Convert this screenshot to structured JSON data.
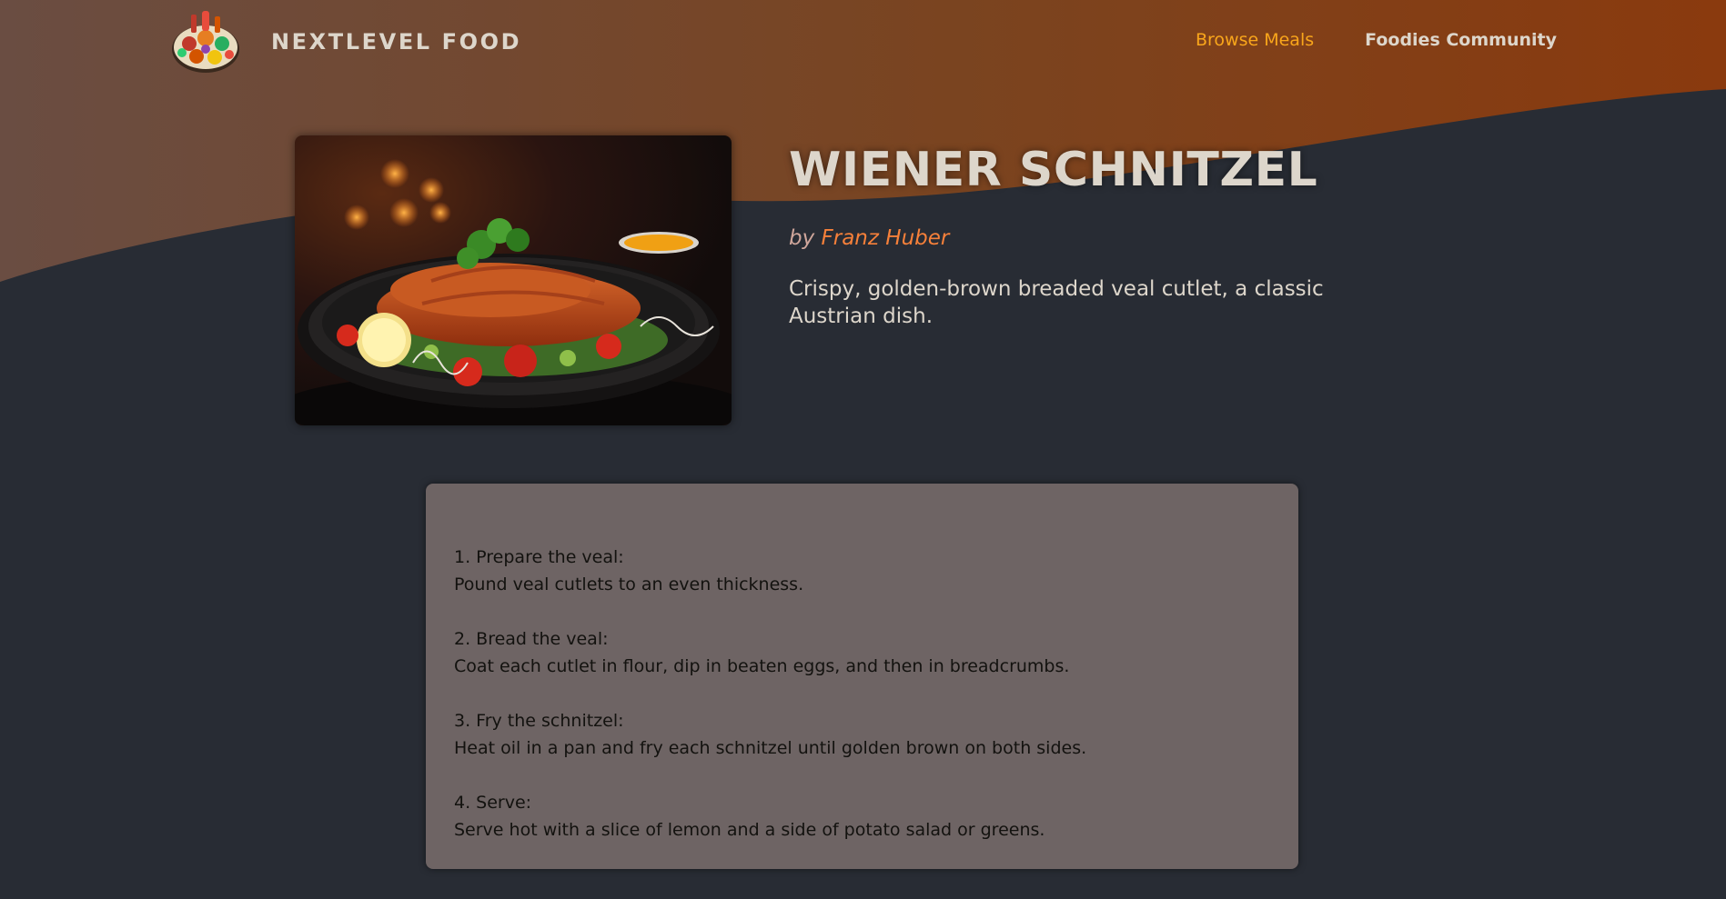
{
  "colors": {
    "background": "#282c34",
    "header_gradient_start": "#6c4a3e",
    "header_gradient_end": "#8a3a10",
    "brand_text": "#ddd6cb",
    "nav_active": "#f9a61b",
    "creator_link": "#f6803a",
    "instructions_bg": "#6e6464"
  },
  "header": {
    "logo_alt_icon": "food-platter-icon",
    "brand": "NEXTLEVEL FOOD",
    "nav": [
      {
        "label": "Browse Meals",
        "active": true
      },
      {
        "label": "Foodies Community",
        "active": false
      }
    ]
  },
  "meal": {
    "image_icon": "wiener-schnitzel-photo",
    "title": "WIENER SCHNITZEL",
    "by_label": "by",
    "creator": "Franz Huber",
    "summary": "Crispy, golden-brown breaded veal cutlet, a classic Austrian dish."
  },
  "instructions": [
    {
      "heading": "1. Prepare the veal:",
      "text": "Pound veal cutlets to an even thickness."
    },
    {
      "heading": "2. Bread the veal:",
      "text": "Coat each cutlet in flour, dip in beaten eggs, and then in breadcrumbs."
    },
    {
      "heading": "3. Fry the schnitzel:",
      "text": "Heat oil in a pan and fry each schnitzel until golden brown on both sides."
    },
    {
      "heading": "4. Serve:",
      "text": "Serve hot with a slice of lemon and a side of potato salad or greens."
    }
  ]
}
